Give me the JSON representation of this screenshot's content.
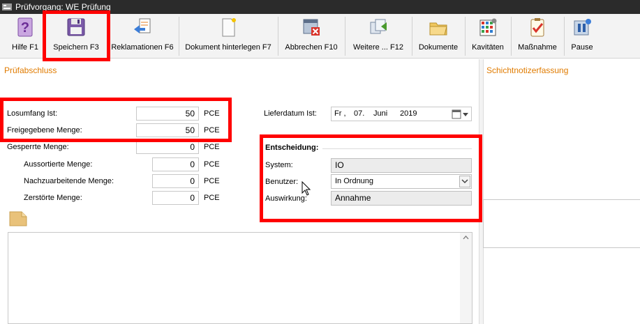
{
  "window": {
    "title": "Prüfvorgang: WE Prüfung"
  },
  "toolbar": {
    "buttons": [
      {
        "label": "Hilfe F1",
        "icon": "help-icon"
      },
      {
        "label": "Speichern F3",
        "icon": "floppy-disk-icon"
      },
      {
        "label": "Reklamationen F6",
        "icon": "complaints-icon"
      },
      {
        "label": "Dokument hinterlegen F7",
        "icon": "document-new-icon"
      },
      {
        "label": "Abbrechen F10",
        "icon": "cancel-icon"
      },
      {
        "label": "Weitere ... F12",
        "icon": "more-icon"
      },
      {
        "label": "Dokumente",
        "icon": "folder-icon"
      },
      {
        "label": "Kavitäten",
        "icon": "cavities-grid-icon"
      },
      {
        "label": "Maßnahme",
        "icon": "clipboard-check-icon"
      },
      {
        "label": "Pause",
        "icon": "pause-icon"
      }
    ]
  },
  "pruefabschluss": {
    "title": "Prüfabschluss",
    "losumfang": {
      "label": "Losumfang Ist:",
      "value": "50",
      "unit": "PCE"
    },
    "freigegeben": {
      "label": "Freigegebene Menge:",
      "value": "50",
      "unit": "PCE"
    },
    "gesperrt": {
      "label": "Gesperrte Menge:",
      "value": "0",
      "unit": "PCE"
    },
    "aussortiert": {
      "label": "Aussortierte Menge:",
      "value": "0",
      "unit": "PCE"
    },
    "nacharbeit": {
      "label": "Nachzuarbeitende Menge:",
      "value": "0",
      "unit": "PCE"
    },
    "zerstoert": {
      "label": "Zerstörte Menge:",
      "value": "0",
      "unit": "PCE"
    },
    "lieferdatum": {
      "label": "Lieferdatum Ist:",
      "weekday": "Fr ,",
      "day": "07.",
      "month": "Juni",
      "year": "2019"
    },
    "entscheidung": {
      "title": "Entscheidung:",
      "system_label": "System:",
      "system_value": "IO",
      "benutzer_label": "Benutzer:",
      "benutzer_value": "In Ordnung",
      "auswirkung_label": "Auswirkung:",
      "auswirkung_value": "Annahme"
    }
  },
  "schichtnotiz": {
    "title": "Schichtnotizerfassung"
  },
  "colors": {
    "accent": "#e07b00",
    "highlight": "#ff0000",
    "titlebar": "#2b2b2b"
  }
}
